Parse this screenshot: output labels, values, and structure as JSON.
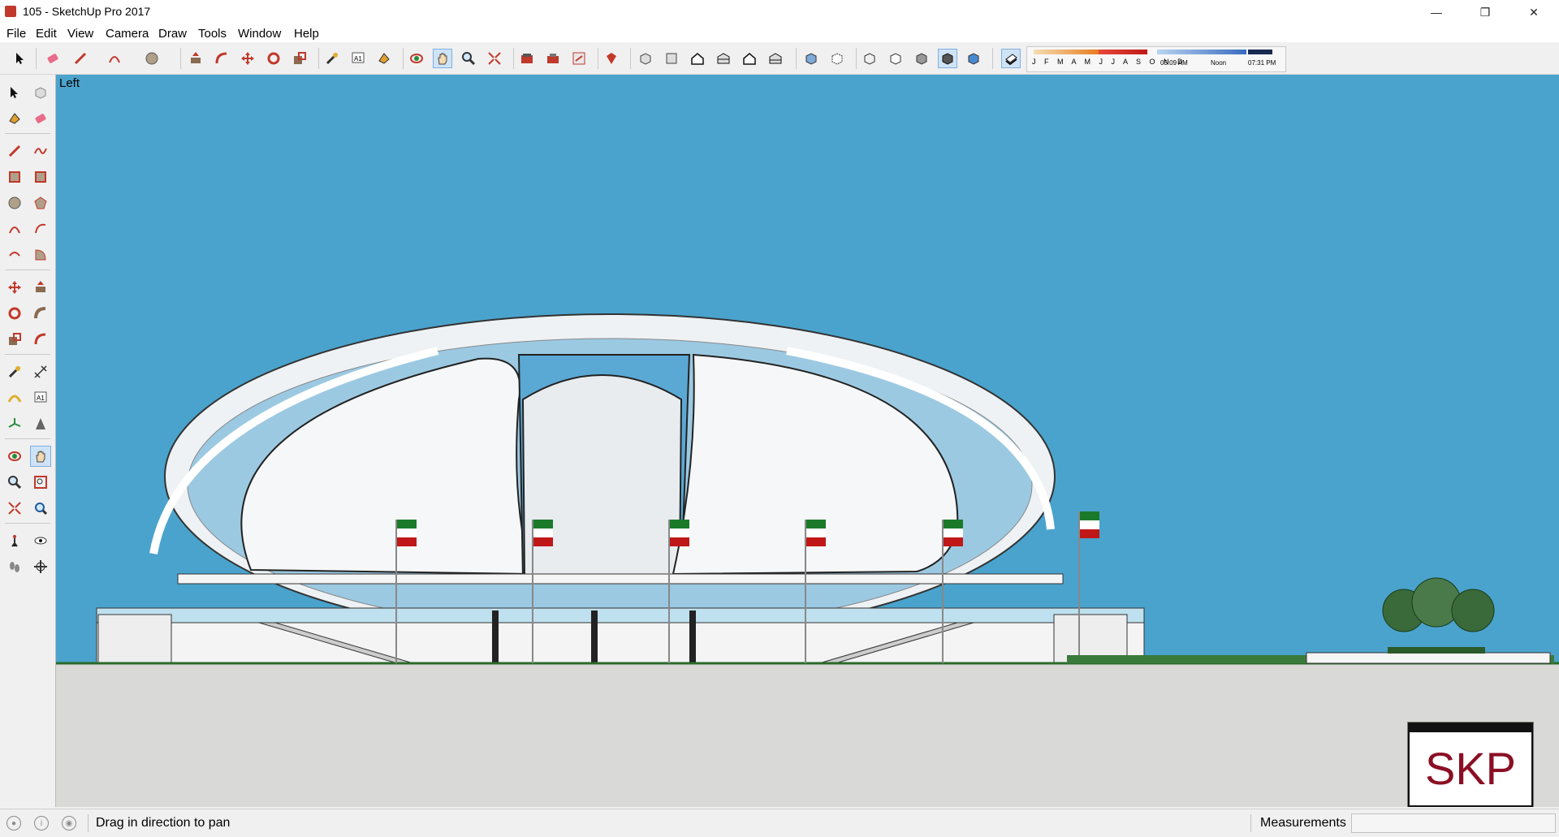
{
  "window": {
    "title": "105 - SketchUp Pro 2017",
    "minimize": "—",
    "restore": "❐",
    "close": "✕"
  },
  "menu": {
    "items": [
      "File",
      "Edit",
      "View",
      "Camera",
      "Draw",
      "Tools",
      "Window",
      "Help"
    ]
  },
  "toolbar": {
    "tools": [
      "select-icon",
      "eraser-icon",
      "pencil-icon",
      "arc-icon",
      "circle-icon",
      "pushpull-icon",
      "followme-icon",
      "move-icon",
      "rotate-icon",
      "scale-icon",
      "tape-icon",
      "text-icon",
      "paint-icon",
      "orbit-icon",
      "pan-icon",
      "zoom-icon",
      "zoom-extents-icon",
      "warehouse-icon",
      "extension-icon",
      "send-layout-icon",
      "ruby-icon",
      "iso-view-icon",
      "top-view-icon",
      "front-view-icon",
      "right-view-icon",
      "back-view-icon",
      "left-view-icon",
      "xray-icon",
      "back-edges-icon",
      "wireframe-icon",
      "hidden-line-icon",
      "shaded-icon",
      "shaded-textures-icon",
      "monochrome-icon",
      "shadows-icon"
    ],
    "shadow_months": "J F M A M J J A S O N D",
    "shadow_times": [
      "05:09 AM",
      "Noon",
      "07:31 PM"
    ]
  },
  "viewport": {
    "scene_label": "Left",
    "sky_color": "#4aa3cc",
    "ground_color": "#d9d9d7"
  },
  "logo": {
    "text": "SKP",
    "color": "#8b0f24"
  },
  "status": {
    "hint": "Drag in direction to pan",
    "measurements_label": "Measurements",
    "measurements_value": ""
  },
  "colors": {
    "accent": "#cfe3f7",
    "flag_green": "#1a7a2a",
    "flag_red": "#c01818"
  }
}
